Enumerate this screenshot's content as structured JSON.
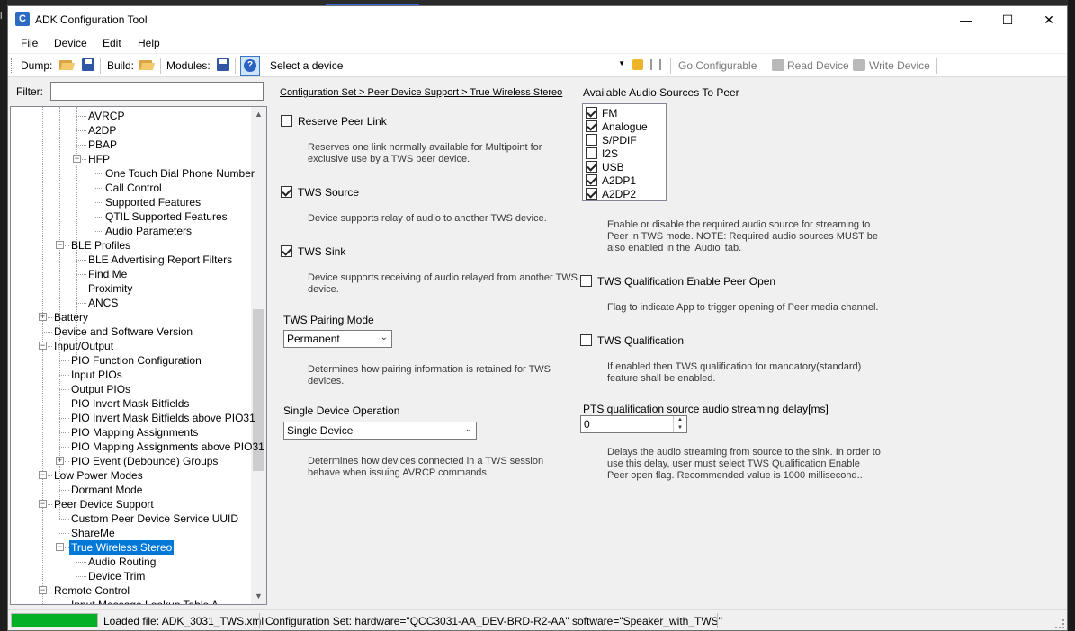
{
  "window": {
    "title": "ADK Configuration Tool",
    "controls": {
      "minimize": "—",
      "maximize": "☐",
      "close": "✕"
    }
  },
  "menu": [
    "File",
    "Device",
    "Edit",
    "Help"
  ],
  "toolbar": {
    "dump_label": "Dump:",
    "build_label": "Build:",
    "modules_label": "Modules:",
    "device_select": "Select a device",
    "go_configurable": "Go Configurable",
    "read_device": "Read Device",
    "write_device": "Write Device"
  },
  "filter": {
    "label": "Filter:",
    "value": ""
  },
  "tree": [
    {
      "label": "AVRCP",
      "level": 2
    },
    {
      "label": "A2DP",
      "level": 2
    },
    {
      "label": "PBAP",
      "level": 2
    },
    {
      "label": "HFP",
      "level": 2,
      "expander": "minus"
    },
    {
      "label": "One Touch Dial Phone Number",
      "level": 3
    },
    {
      "label": "Call Control",
      "level": 3
    },
    {
      "label": "Supported Features",
      "level": 3
    },
    {
      "label": "QTIL Supported Features",
      "level": 3
    },
    {
      "label": "Audio Parameters",
      "level": 3
    },
    {
      "label": "BLE Profiles",
      "level": 1,
      "expander": "minus"
    },
    {
      "label": "BLE Advertising Report Filters",
      "level": 2
    },
    {
      "label": "Find Me",
      "level": 2
    },
    {
      "label": "Proximity",
      "level": 2
    },
    {
      "label": "ANCS",
      "level": 2
    },
    {
      "label": "Battery",
      "level": 0,
      "expander": "plus"
    },
    {
      "label": "Device and Software Version",
      "level": 0
    },
    {
      "label": "Input/Output",
      "level": 0,
      "expander": "minus"
    },
    {
      "label": "PIO Function Configuration",
      "level": 1
    },
    {
      "label": "Input PIOs",
      "level": 1
    },
    {
      "label": "Output PIOs",
      "level": 1
    },
    {
      "label": "PIO Invert Mask Bitfields",
      "level": 1
    },
    {
      "label": "PIO Invert Mask Bitfields above PIO31",
      "level": 1
    },
    {
      "label": "PIO Mapping Assignments",
      "level": 1
    },
    {
      "label": "PIO Mapping Assignments above PIO31",
      "level": 1
    },
    {
      "label": "PIO Event (Debounce) Groups",
      "level": 1,
      "expander": "plus"
    },
    {
      "label": "Low Power Modes",
      "level": 0,
      "expander": "minus"
    },
    {
      "label": "Dormant Mode",
      "level": 1
    },
    {
      "label": "Peer Device Support",
      "level": 0,
      "expander": "minus"
    },
    {
      "label": "Custom Peer Device Service UUID",
      "level": 1
    },
    {
      "label": "ShareMe",
      "level": 1
    },
    {
      "label": "True Wireless Stereo",
      "level": 1,
      "expander": "minus",
      "selected": true
    },
    {
      "label": "Audio Routing",
      "level": 2
    },
    {
      "label": "Device Trim",
      "level": 2
    },
    {
      "label": "Remote Control",
      "level": 0,
      "expander": "minus"
    },
    {
      "label": "Input Message Lookup Table A",
      "level": 1
    }
  ],
  "content": {
    "breadcrumb": "Configuration Set > Peer Device Support > True Wireless Stereo",
    "reserve_peer_link": {
      "label": "Reserve Peer Link",
      "checked": false,
      "desc1": "Reserves one link normally available for Multipoint for",
      "desc2": "exclusive use by a TWS peer device."
    },
    "tws_source": {
      "label": "TWS Source",
      "checked": true,
      "desc1": "Device supports relay of audio to another TWS device."
    },
    "tws_sink": {
      "label": "TWS Sink",
      "checked": true,
      "desc1": "Device supports receiving of audio relayed from another TWS",
      "desc2": "device."
    },
    "pairing_mode": {
      "label": "TWS Pairing Mode",
      "value": "Permanent",
      "desc1": "Determines how pairing information is retained for TWS",
      "desc2": "devices."
    },
    "single_device": {
      "label": "Single Device Operation",
      "value": "Single Device",
      "desc1": "Determines how devices connected in a TWS session",
      "desc2": "behave when issuing AVRCP commands."
    },
    "audio_sources": {
      "label": "Available Audio Sources To Peer",
      "items": [
        {
          "label": "FM",
          "checked": true
        },
        {
          "label": "Analogue",
          "checked": true
        },
        {
          "label": "S/PDIF",
          "checked": false
        },
        {
          "label": "I2S",
          "checked": false
        },
        {
          "label": "USB",
          "checked": true
        },
        {
          "label": "A2DP1",
          "checked": true
        },
        {
          "label": "A2DP2",
          "checked": true
        }
      ],
      "desc1": "Enable or disable the required audio source for streaming to",
      "desc2": "Peer in TWS mode. NOTE: Required audio sources MUST be",
      "desc3": "also enabled in the 'Audio' tab."
    },
    "qual_enable_peer_open": {
      "label": "TWS Qualification Enable Peer Open",
      "checked": false,
      "desc1": "Flag to indicate App to trigger opening of Peer media channel."
    },
    "tws_qualification": {
      "label": "TWS Qualification",
      "checked": false,
      "desc1": "If enabled then TWS qualification for mandatory(standard)",
      "desc2": "feature shall be enabled."
    },
    "pts_delay": {
      "label": "PTS qualification source audio streaming delay[ms]",
      "value": "0",
      "desc1": "Delays the audio streaming from source to the sink. In order to",
      "desc2": "use this delay, user must select TWS Qualification Enable",
      "desc3": "Peer open flag. Recommended value is 1000 millisecond.."
    }
  },
  "status": {
    "progress": 1.0,
    "loaded_file": "Loaded file: ADK_3031_TWS.xml",
    "config_set": "Configuration Set:  hardware=\"QCC3031-AA_DEV-BRD-R2-AA\" software=\"Speaker_with_TWS\""
  },
  "colors": {
    "selection": "#0078d7",
    "progress": "#06b025",
    "app_icon": "#2d6bc2"
  }
}
